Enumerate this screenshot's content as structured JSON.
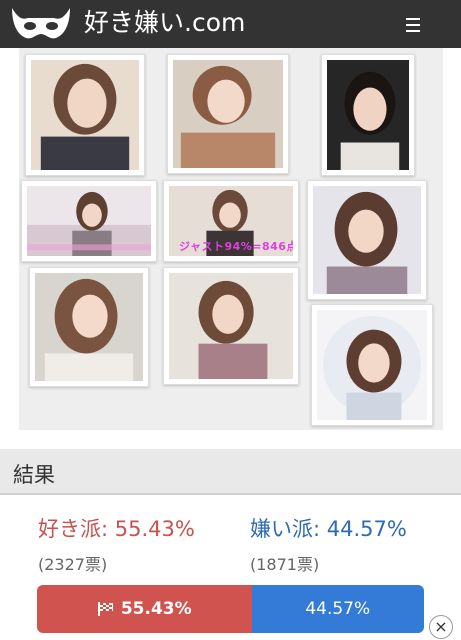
{
  "header": {
    "site_title": "好き嫌い.com",
    "logo_icon": "mask-icon",
    "menu_icon": "hamburger-menu-icon"
  },
  "gallery": {
    "photos": [
      {
        "name": "photo-1"
      },
      {
        "name": "photo-2"
      },
      {
        "name": "photo-3"
      },
      {
        "name": "photo-4"
      },
      {
        "name": "photo-5",
        "caption": "ジャスト94%=846点"
      },
      {
        "name": "photo-6"
      },
      {
        "name": "photo-7"
      },
      {
        "name": "photo-8"
      },
      {
        "name": "photo-9"
      }
    ]
  },
  "result": {
    "title": "結果",
    "like_label": "好き派: 55.43%",
    "dislike_label": "嫌い派: 44.57%",
    "like_votes": "(2327票)",
    "dislike_votes": "(1871票)",
    "like_bar_label": "55.43%",
    "dislike_bar_label": "44.57%",
    "like_percent": 55.43,
    "like_color": "#d0534f",
    "dislike_color": "#337bd6"
  },
  "ad_close": {
    "label": "×",
    "icon": "close-icon"
  }
}
